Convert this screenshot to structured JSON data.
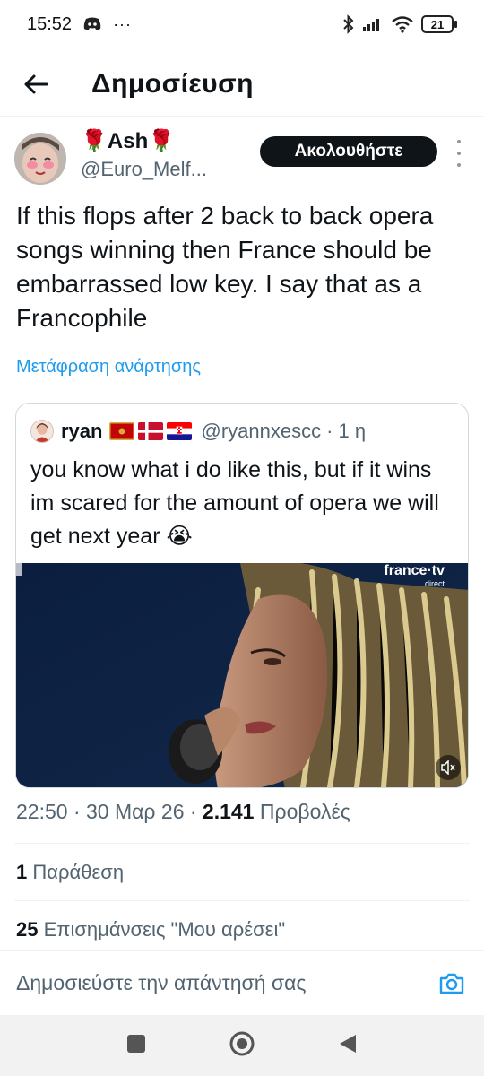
{
  "status_bar": {
    "time": "15:52",
    "notification_icons": [
      "discord-icon",
      "more-dots-icon"
    ],
    "system_icons": [
      "bluetooth-icon",
      "signal-icon",
      "wifi-icon"
    ],
    "battery": "21"
  },
  "header": {
    "title": "Δημοσίευση",
    "back_icon": "arrow-left-icon"
  },
  "tweet": {
    "author_name": "🌹Ash🌹",
    "author_handle": "@Euro_Melf...",
    "follow_label": "Ακολουθήστε",
    "text": "If this flops after 2 back to back opera songs winning then France should be embarrassed low key. I say that as a Francophile",
    "translate_label": "Μετάφραση ανάρτησης",
    "quote": {
      "name": "ryan",
      "flags": [
        "montenegro-flag",
        "denmark-flag",
        "croatia-flag"
      ],
      "handle": "@ryannxescc",
      "time": "· 1 η",
      "text": "you know what i do like this, but if it wins im scared for the amount of opera we will get next year 😭",
      "media_watermark": "france·tv",
      "media_watermark_sub": "direct"
    },
    "timestamp": "22:50 · 30 Μαρ 26 ·",
    "views_count": "2.141",
    "views_label": "Προβολές",
    "quotes_count": "1",
    "quotes_label": "Παράθεση",
    "likes_count": "25",
    "likes_label": "Επισημάνσεις \"Μου αρέσει\""
  },
  "reply": {
    "placeholder": "Δημοσιεύστε την απάντησή σας"
  },
  "colors": {
    "accent": "#1d9bf0",
    "text_primary": "#0f1419",
    "text_secondary": "#536471",
    "border": "#cfd9de"
  }
}
